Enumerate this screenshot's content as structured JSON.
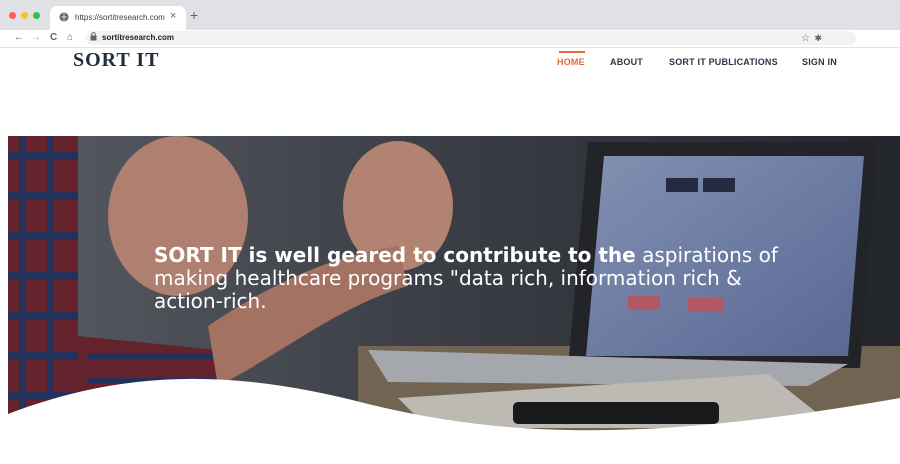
{
  "browser": {
    "tab_title": "https://sortitresearch.com",
    "tab_close": "×",
    "new_tab": "+",
    "url": "sortitresearch.com",
    "nav": {
      "back": "←",
      "forward": "→",
      "reload": "C",
      "home": "⌂"
    },
    "star": "☆",
    "extension": "✱",
    "lock": "🔒"
  },
  "site": {
    "logo_text": "SORT IT",
    "nav_items": [
      {
        "label": "HOME",
        "active": true
      },
      {
        "label": "ABOUT",
        "active": false
      },
      {
        "label": "SORT IT PUBLICATIONS",
        "active": false
      },
      {
        "label": "SIGN IN",
        "active": false
      }
    ],
    "accent_color": "#e26b3a"
  },
  "hero": {
    "headline_bold": "SORT IT is well geared to contribute to the",
    "headline_regular": "aspirations of making healthcare programs \"data rich, information rich & action-rich."
  }
}
